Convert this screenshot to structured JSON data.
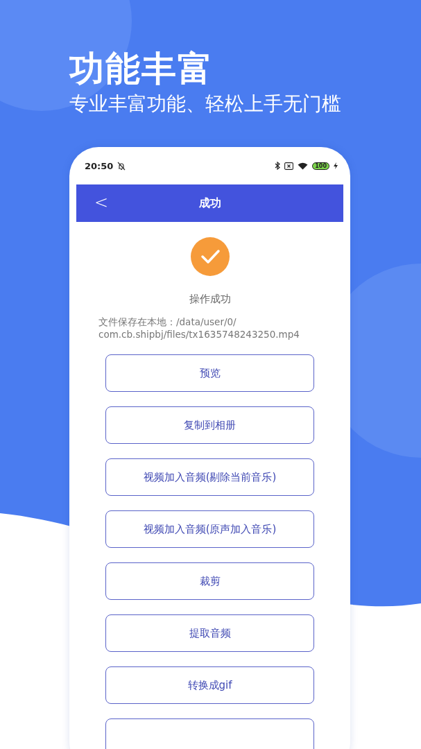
{
  "promo": {
    "title": "功能丰富",
    "subtitle": "专业丰富功能、轻松上手无门槛"
  },
  "status_bar": {
    "time": "20:50",
    "battery": "100"
  },
  "app_bar": {
    "back": "<",
    "title": "成功"
  },
  "result": {
    "message": "操作成功",
    "path_lines": [
      "文件保存在本地：/data/user/0/",
      "com.cb.shipbj/files/tx1635748243250.mp4"
    ]
  },
  "actions": [
    {
      "kind": "button",
      "label": "预览"
    },
    {
      "kind": "button",
      "label": "复制到相册"
    },
    {
      "kind": "button",
      "label": "视频加入音频(剔除当前音乐)"
    },
    {
      "kind": "button",
      "label": "视频加入音频(原声加入音乐)"
    },
    {
      "kind": "button",
      "label": "裁剪"
    },
    {
      "kind": "button",
      "label": "提取音频"
    },
    {
      "kind": "button",
      "label": "转换成gif"
    },
    {
      "kind": "cut_off"
    }
  ]
}
